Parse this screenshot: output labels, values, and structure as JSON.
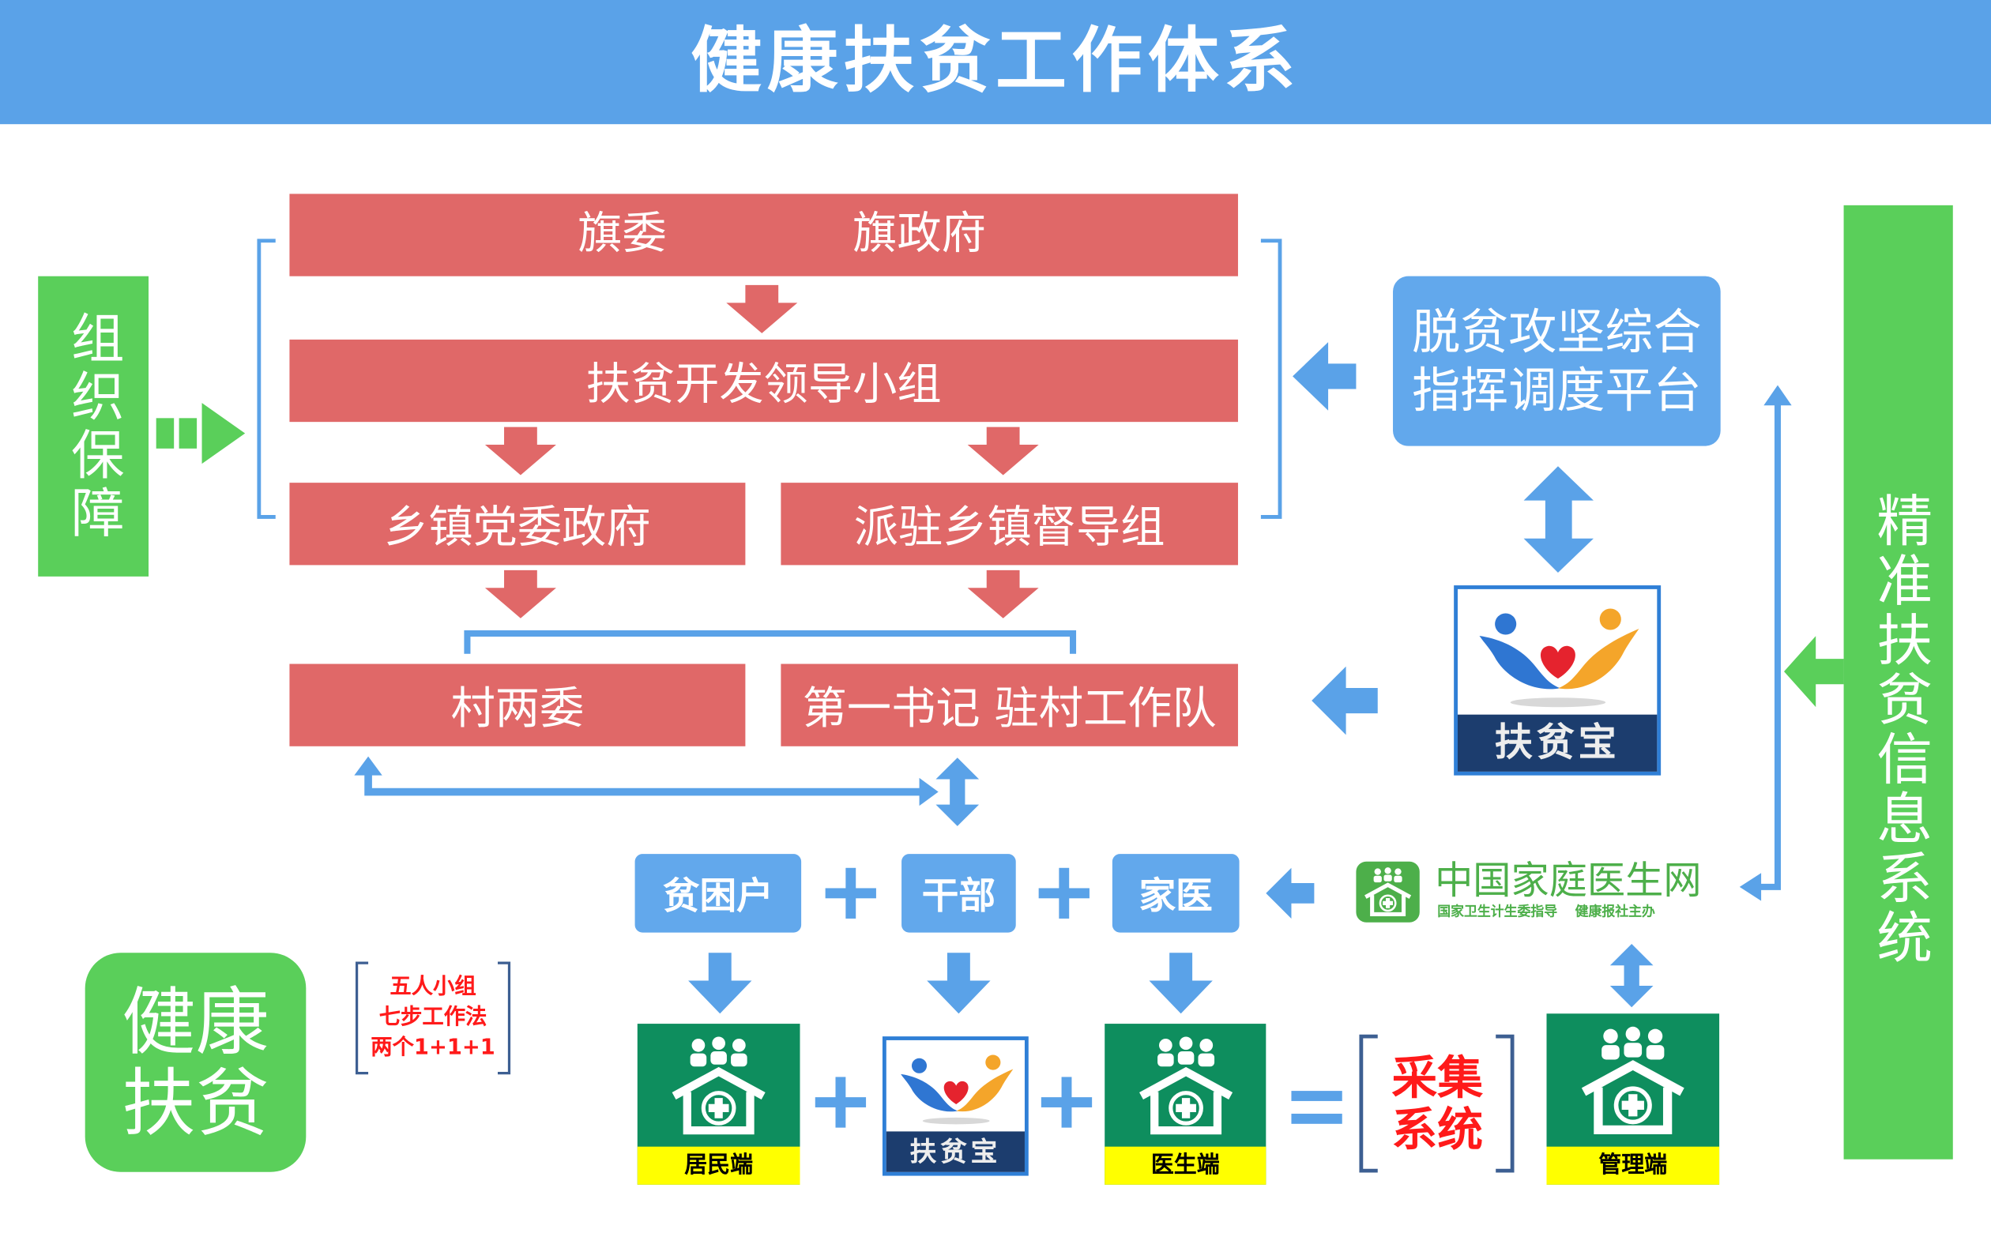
{
  "title": "健康扶贫工作体系",
  "organization": {
    "label": "组织保障"
  },
  "hierarchy": {
    "level1": {
      "left": "旗委",
      "right": "旗政府"
    },
    "level2": "扶贫开发领导小组",
    "level3": {
      "left": "乡镇党委政府",
      "right": "派驻乡镇督导组"
    },
    "level4": {
      "left": "村两委",
      "right": "第一书记 驻村工作队"
    }
  },
  "command_platform": {
    "line1": "脱贫攻坚综合",
    "line2": "指挥调度平台"
  },
  "fupinbao": {
    "label": "扶贫宝"
  },
  "info_system": {
    "label": "精准扶贫信息系统"
  },
  "team": {
    "poor_household": "贫困户",
    "cadre": "干部",
    "family_doctor": "家医"
  },
  "family_doctor_network": {
    "name": "中国家庭医生网",
    "guidance": "国家卫生计生委指导",
    "host": "健康报社主办"
  },
  "terminals": {
    "resident": "居民端",
    "fupinbao": "扶贫宝",
    "doctor": "医生端",
    "management": "管理端"
  },
  "collection_system": {
    "line1": "采集",
    "line2": "系统"
  },
  "health_poverty": {
    "line1": "健康",
    "line2": "扶贫"
  },
  "methods": [
    "五人小组",
    "七步工作法",
    "两个1+1+1"
  ],
  "icons": {
    "terminal": "house-medical-icon",
    "fupinbao": "hands-heart-logo-icon"
  },
  "colors": {
    "header": "#5AA2E8",
    "green": "#5ACF5A",
    "red_box": "#E06868",
    "blue_box": "#62A8EC",
    "terminal_green": "#0E8E5E",
    "terminal_band": "#FFFF00",
    "accent_red": "#FF1A1A",
    "fupinbao_band": "#1C3D6E",
    "network_green": "#4DAF4A",
    "line_blue": "#5AA2E8"
  }
}
